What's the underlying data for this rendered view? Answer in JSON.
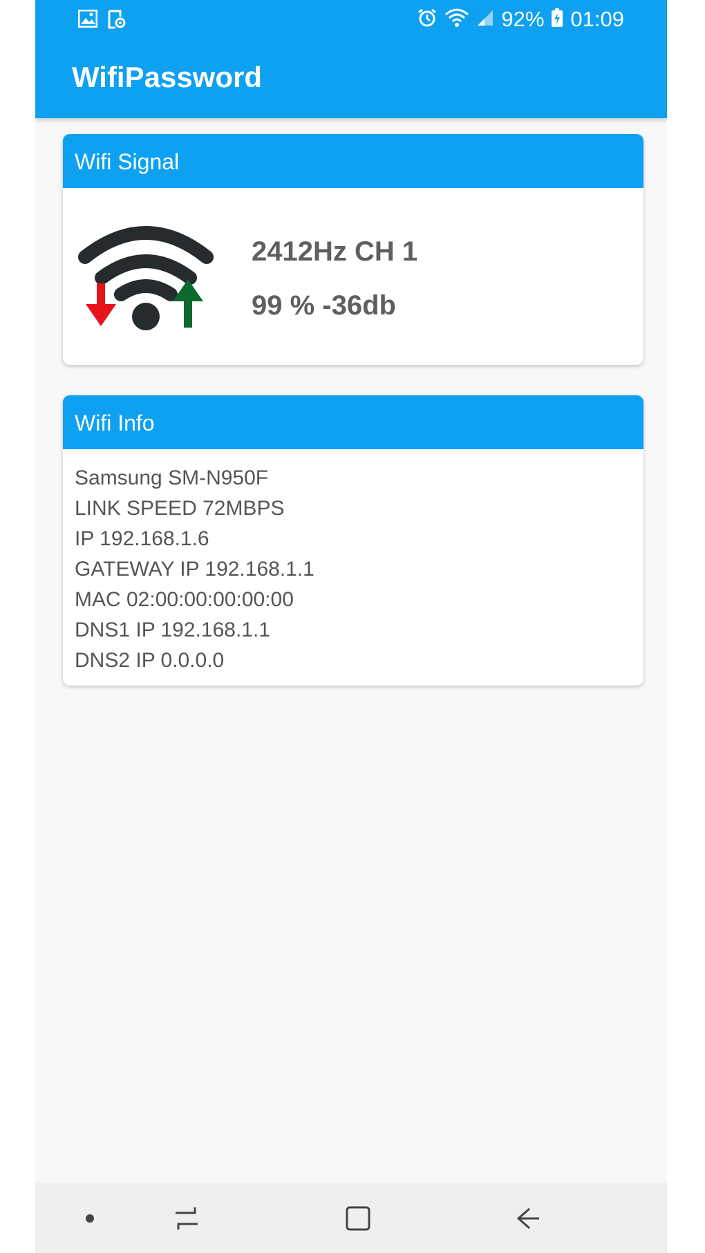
{
  "status_bar": {
    "battery": "92%",
    "time": "01:09",
    "left_icons": [
      "image-icon",
      "screen-record-icon"
    ],
    "right_icons": [
      "alarm-icon",
      "wifi-status-icon",
      "cell-signal-icon",
      "battery-charging-icon"
    ]
  },
  "app": {
    "title": "WifiPassword"
  },
  "signal_card": {
    "header": "Wifi Signal",
    "frequency": "2412Hz CH 1",
    "level": "99 % -36db"
  },
  "info_card": {
    "header": "Wifi Info",
    "lines": [
      "Samsung SM-N950F",
      "LINK SPEED 72MBPS",
      "IP 192.168.1.6",
      "GATEWAY IP 192.168.1.1",
      "MAC 02:00:00:00:00:00",
      "DNS1 IP 192.168.1.1",
      "DNS2 IP 0.0.0.0"
    ]
  },
  "nav_bar": {
    "icons": [
      "dot-icon",
      "recent-apps-icon",
      "home-icon",
      "back-icon"
    ]
  },
  "colors": {
    "primary": "#0ea1f2",
    "download_arrow": "#e8141c",
    "upload_arrow": "#0c6a2e",
    "wifi_arcs": "#262b2d"
  }
}
